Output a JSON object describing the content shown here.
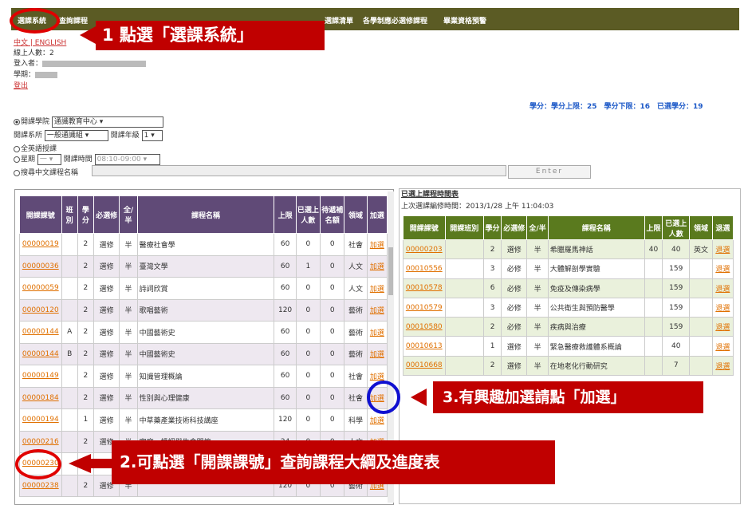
{
  "nav": {
    "items": [
      "選課系統",
      "查詢課程",
      "選課清單",
      "各學制應必選修課程",
      "畢業資格預警"
    ]
  },
  "info": {
    "lang_link": "中文 | ENGLISH",
    "online": "線上人數：2",
    "login": "登入者：",
    "semester": "學期：",
    "logout": "登出"
  },
  "credits": "學分：學分上限：25　學分下限：16　已選學分：19",
  "form": {
    "college_label": "開課學院",
    "college_value": "通識教育中心",
    "dept_label": "開課系所",
    "dept_value": "一般通識組",
    "grade_label": "開課年級",
    "grade_value": "1",
    "english": "全英語授課",
    "week_label": "星期",
    "week_value": "一",
    "time_label": "開課時間",
    "time_value": "08:10-09:00",
    "search_label": "搜尋中文課程名稱",
    "enter": "Enter"
  },
  "left_table": {
    "headers": [
      "開課課號",
      "班別",
      "學分",
      "必選修",
      "全/半",
      "課程名稱",
      "上限",
      "已選上人數",
      "待遞補名額",
      "領域",
      "加選"
    ],
    "rows": [
      [
        "00000019",
        "",
        "2",
        "選修",
        "半",
        "醫療社會學",
        "60",
        "0",
        "0",
        "社會",
        "加選"
      ],
      [
        "00000036",
        "",
        "2",
        "選修",
        "半",
        "臺灣文學",
        "60",
        "1",
        "0",
        "人文",
        "加選"
      ],
      [
        "00000059",
        "",
        "2",
        "選修",
        "半",
        "詩詞欣賞",
        "60",
        "0",
        "0",
        "人文",
        "加選"
      ],
      [
        "00000120",
        "",
        "2",
        "選修",
        "半",
        "歌唱藝術",
        "120",
        "0",
        "0",
        "藝術",
        "加選"
      ],
      [
        "00000144",
        "A",
        "2",
        "選修",
        "半",
        "中國藝術史",
        "60",
        "0",
        "0",
        "藝術",
        "加選"
      ],
      [
        "00000144",
        "B",
        "2",
        "選修",
        "半",
        "中國藝術史",
        "60",
        "0",
        "0",
        "藝術",
        "加選"
      ],
      [
        "00000149",
        "",
        "2",
        "選修",
        "半",
        "知識管理概論",
        "60",
        "0",
        "0",
        "社會",
        "加選"
      ],
      [
        "00000184",
        "",
        "2",
        "選修",
        "半",
        "性別與心理健康",
        "60",
        "0",
        "0",
        "社會",
        "加選"
      ],
      [
        "00000194",
        "",
        "1",
        "選修",
        "半",
        "中草藥產業技術科技講座",
        "120",
        "0",
        "0",
        "科學",
        "加選"
      ],
      [
        "00000216",
        "",
        "2",
        "選修",
        "半",
        "家庭、婚姻與生命關懷",
        "24",
        "0",
        "0",
        "人文",
        "加選"
      ],
      [
        "00000230",
        "",
        "2",
        "選修",
        "半",
        "",
        "",
        "",
        "",
        "",
        "加選"
      ],
      [
        "00000238",
        "",
        "2",
        "選修",
        "半",
        "",
        "120",
        "0",
        "0",
        "藝術",
        "加選"
      ]
    ]
  },
  "right_table": {
    "title": "已選上課程時間表",
    "subtitle": "上次選課編修時間：2013/1/28 上午 11:04:03",
    "headers": [
      "開課課號",
      "開課班別",
      "學分",
      "必選修",
      "全/半",
      "課程名稱",
      "上限",
      "已選上人數",
      "領域",
      "退選"
    ],
    "rows": [
      [
        "00000203",
        "",
        "2",
        "選修",
        "半",
        "希臘羅馬神話",
        "40",
        "40",
        "英文",
        "退選"
      ],
      [
        "00010556",
        "",
        "3",
        "必修",
        "半",
        "大體解剖學實驗",
        "",
        "159",
        "",
        "退選"
      ],
      [
        "00010578",
        "",
        "6",
        "必修",
        "半",
        "免疫及傳染病學",
        "",
        "159",
        "",
        "退選"
      ],
      [
        "00010579",
        "",
        "3",
        "必修",
        "半",
        "公共衛生與預防醫學",
        "",
        "159",
        "",
        "退選"
      ],
      [
        "00010580",
        "",
        "2",
        "必修",
        "半",
        "疾病與治療",
        "",
        "159",
        "",
        "退選"
      ],
      [
        "00010613",
        "",
        "1",
        "選修",
        "半",
        "緊急醫療救護體系概論",
        "",
        "40",
        "",
        "退選"
      ],
      [
        "00010668",
        "",
        "2",
        "選修",
        "半",
        "在地老化行動研究",
        "",
        "7",
        "",
        "退選"
      ]
    ]
  },
  "callouts": {
    "c1": "1 點選「選課系統」",
    "c2": "2.可點選「開課課號」查詢課程大綱及進度表",
    "c3": "3.有興趣加選請點「加選」"
  },
  "colors": {
    "nav": "#5b5b24",
    "left_header": "#604a77",
    "right_header": "#5a7a1e",
    "callout": "#c00000",
    "circle_red": "#e00000",
    "circle_blue": "#1010d0"
  }
}
